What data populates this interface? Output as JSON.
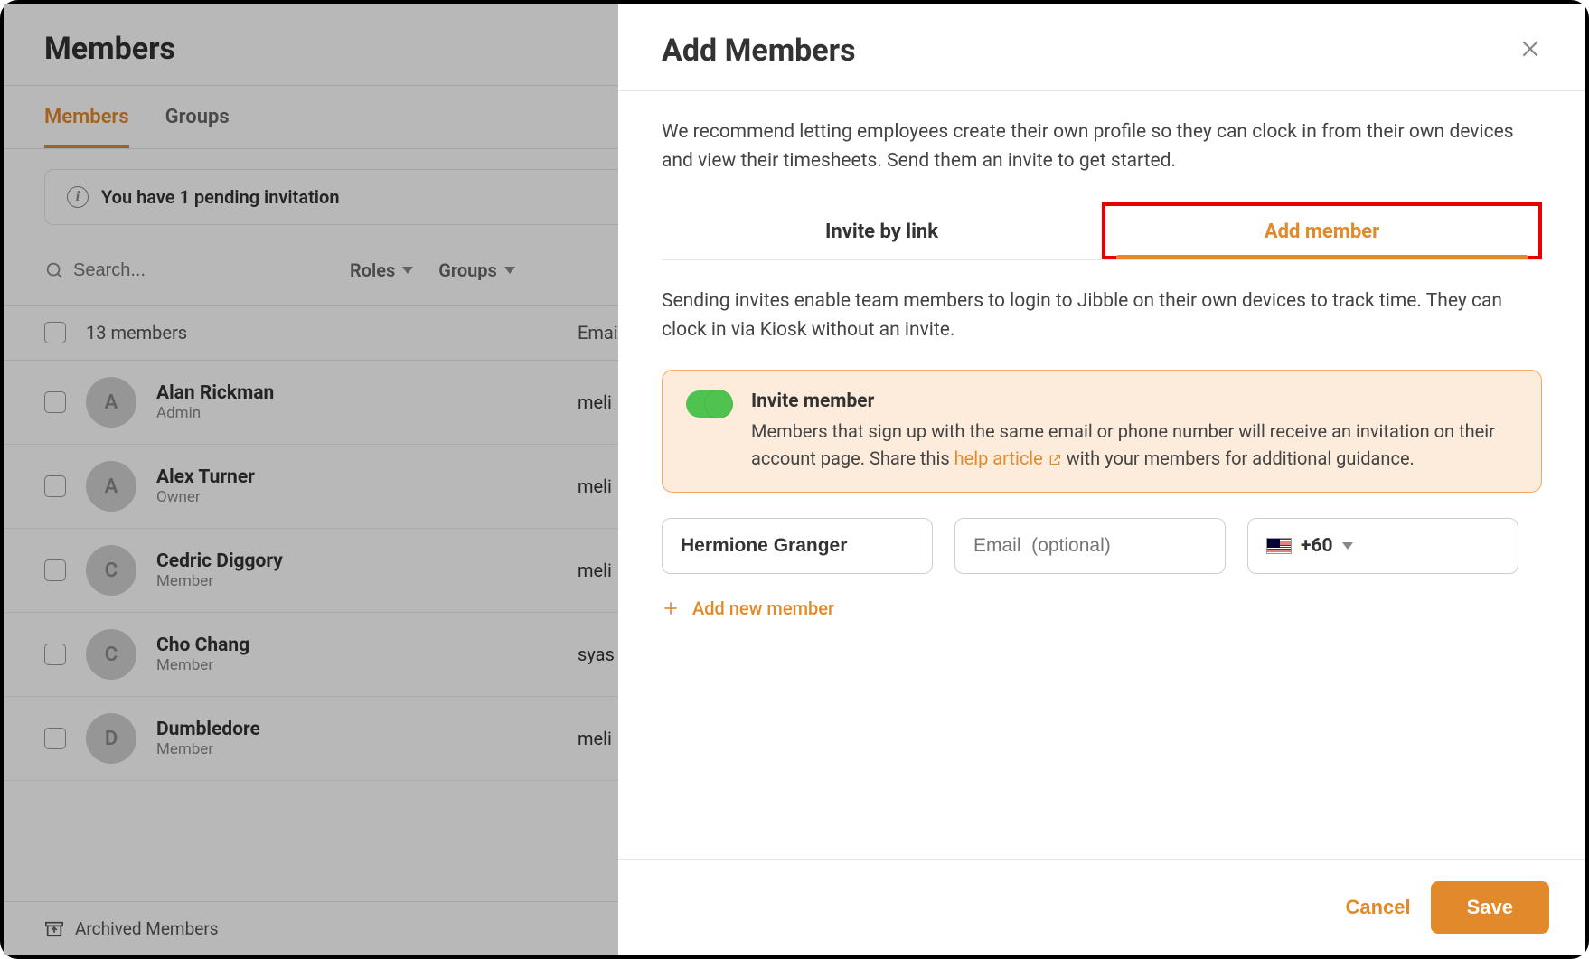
{
  "page": {
    "title": "Members",
    "tabs": [
      "Members",
      "Groups"
    ],
    "notice": "You have 1 pending invitation",
    "search_placeholder": "Search...",
    "filter_roles": "Roles",
    "filter_groups": "Groups",
    "add_small": "+",
    "count_label": "13 members",
    "email_header": "Email",
    "archived_label": "Archived Members"
  },
  "members": [
    {
      "name": "Alan Rickman",
      "role": "Admin",
      "email": "meli",
      "initial": "A"
    },
    {
      "name": "Alex Turner",
      "role": "Owner",
      "email": "meli",
      "initial": "A"
    },
    {
      "name": "Cedric Diggory",
      "role": "Member",
      "email": "meli",
      "initial": "C"
    },
    {
      "name": "Cho Chang",
      "role": "Member",
      "email": "syas",
      "initial": "C"
    },
    {
      "name": "Dumbledore",
      "role": "Member",
      "email": "meli",
      "initial": "D"
    }
  ],
  "modal": {
    "title": "Add Members",
    "intro": "We recommend letting employees create their own profile so they can clock in from their own devices and view their timesheets. Send them an invite to get started.",
    "tab_link": "Invite by link",
    "tab_add": "Add member",
    "sub_note": "Sending invites enable team members to login to Jibble on their own devices to track time. They can clock in via Kiosk without an invite.",
    "invite": {
      "title": "Invite member",
      "desc_pre": "Members that sign up with the same email or phone number will receive an invitation on their account page. Share this ",
      "link": "help article",
      "desc_post": " with your members for additional guidance."
    },
    "form": {
      "name_value": "Hermione Granger",
      "email_placeholder": "Email  (optional)",
      "phone_code": "+60"
    },
    "add_new": "Add new member",
    "cancel": "Cancel",
    "save": "Save"
  }
}
